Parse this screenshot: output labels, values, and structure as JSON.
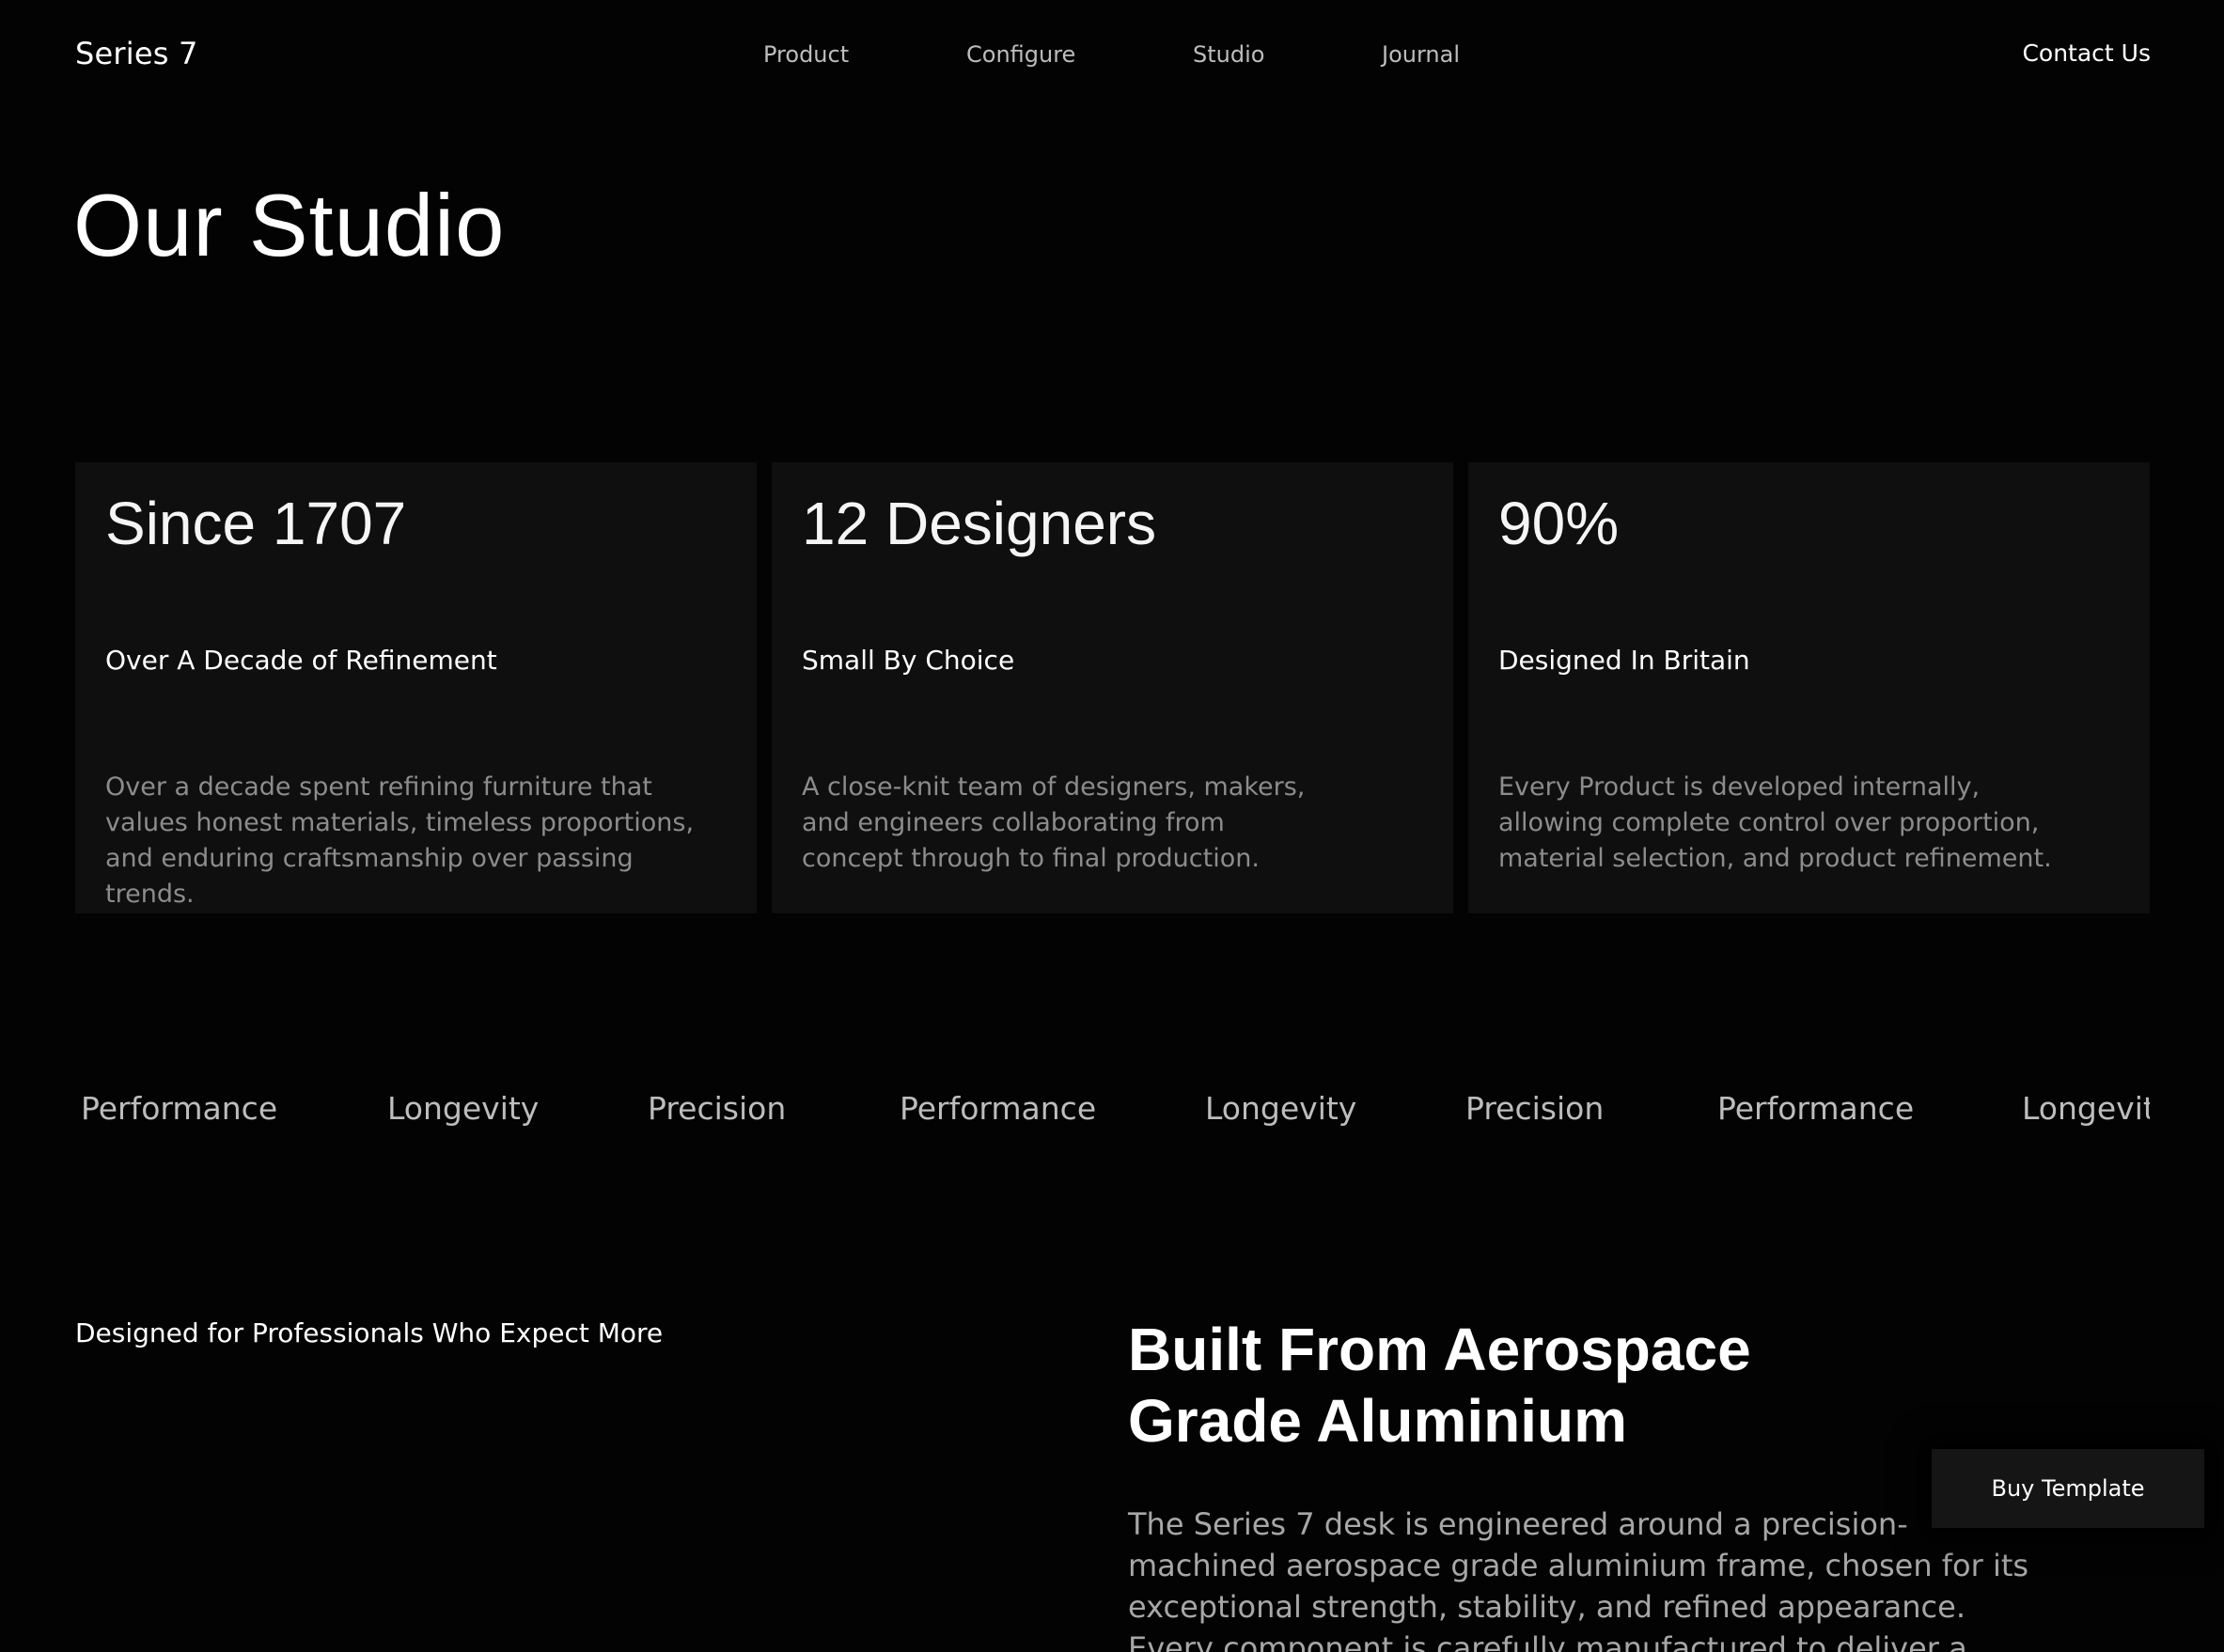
{
  "header": {
    "brand": "Series 7",
    "nav": [
      {
        "label": "Product"
      },
      {
        "label": "Configure"
      },
      {
        "label": "Studio"
      },
      {
        "label": "Journal"
      }
    ],
    "contact_label": "Contact Us"
  },
  "hero": {
    "title": "Our Studio"
  },
  "cards": [
    {
      "value": "Since 1707",
      "subtitle": "Over A Decade of Refinement",
      "body": "Over a decade spent refining furniture that values honest materials, timeless proportions, and enduring craftsmanship over passing trends."
    },
    {
      "value": "12 Designers",
      "subtitle": "Small By Choice",
      "body": "A close-knit team of designers, makers, and engineers collaborating from concept through to final production."
    },
    {
      "value": "90%",
      "subtitle": "Designed In Britain",
      "body": "Every Product is developed internally, allowing complete control over proportion, material selection, and product refinement."
    }
  ],
  "marquee": [
    "Performance",
    "Longevity",
    "Precision",
    "Performance",
    "Longevity",
    "Precision",
    "Performance",
    "Longevity"
  ],
  "lower": {
    "tagline": "Designed for Professionals Who Expect More",
    "heading_line1": "Built From Aerospace",
    "heading_line2": "Grade Aluminium",
    "body": "The Series 7 desk is engineered around a precision-machined aerospace grade aluminium frame, chosen for its exceptional strength, stability, and refined appearance. Every component is carefully manufactured to deliver a workspace that feels"
  },
  "buy_button_label": "Buy Template",
  "colors": {
    "background": "#030303",
    "card_background": "#0f0f0f",
    "muted_text": "#8c8c8c"
  }
}
